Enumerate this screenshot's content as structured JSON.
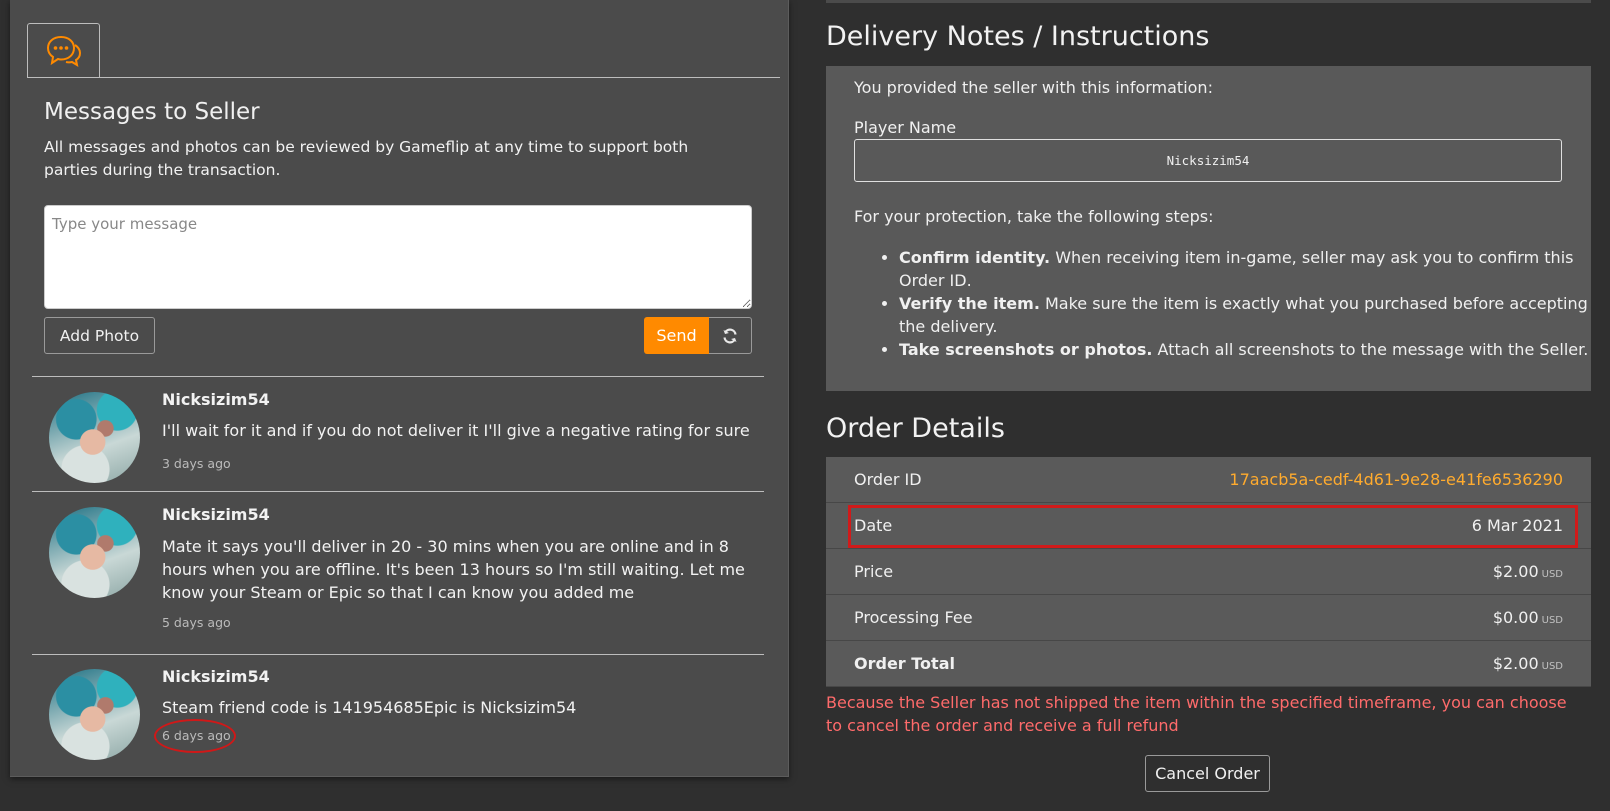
{
  "messages_panel": {
    "chat_tab_icon": "chat-bubbles-icon",
    "title": "Messages to Seller",
    "description": "All messages and photos can be reviewed by Gameflip at any time to support both parties during the transaction.",
    "input_placeholder": "Type your message",
    "add_photo_label": "Add Photo",
    "send_label": "Send",
    "refresh_icon": "refresh-icon",
    "accent_color": "#ff8a00",
    "messages": [
      {
        "author": "Nicksizim54",
        "text": "I'll wait for it and if you do not deliver it I'll give a negative rating for sure",
        "time": "3 days ago"
      },
      {
        "author": "Nicksizim54",
        "text": "Mate it says you'll deliver in 20 - 30 mins when you are online and in 8 hours when you are offline. It's been 13 hours so I'm still waiting. Let me know your Steam or Epic so that I can know you added me",
        "time": "5 days ago"
      },
      {
        "author": "Nicksizim54",
        "text": "Steam friend code is 141954685Epic is Nicksizim54",
        "time": "6 days ago"
      }
    ]
  },
  "delivery": {
    "title": "Delivery Notes / Instructions",
    "intro": "You provided the seller with this information:",
    "field_label": "Player Name",
    "field_value": "Nicksizim54",
    "protection_intro": "For your protection, take the following steps:",
    "steps": [
      {
        "bold": "Confirm identity.",
        "text": " When receiving item in-game, seller may ask you to confirm this Order ID."
      },
      {
        "bold": "Verify the item.",
        "text": " Make sure the item is exactly what you purchased before accepting the delivery."
      },
      {
        "bold": "Take screenshots or photos.",
        "text": " Attach all screenshots to the message with the Seller."
      }
    ]
  },
  "order": {
    "title": "Order Details",
    "rows": {
      "order_id": {
        "label": "Order ID",
        "value": "17aacb5a-cedf-4d61-9e28-e41fe6536290"
      },
      "date": {
        "label": "Date",
        "value": "6 Mar 2021"
      },
      "price": {
        "label": "Price",
        "value": "$2.00",
        "currency": "USD"
      },
      "fee": {
        "label": "Processing Fee",
        "value": "$0.00",
        "currency": "USD"
      },
      "total": {
        "label": "Order Total",
        "value": "$2.00",
        "currency": "USD"
      }
    },
    "cancel_note": "Because the Seller has not shipped the item within the specified timeframe, you can choose to cancel the order and receive a full refund",
    "cancel_label": "Cancel Order",
    "highlight_color": "#d11a1a"
  }
}
